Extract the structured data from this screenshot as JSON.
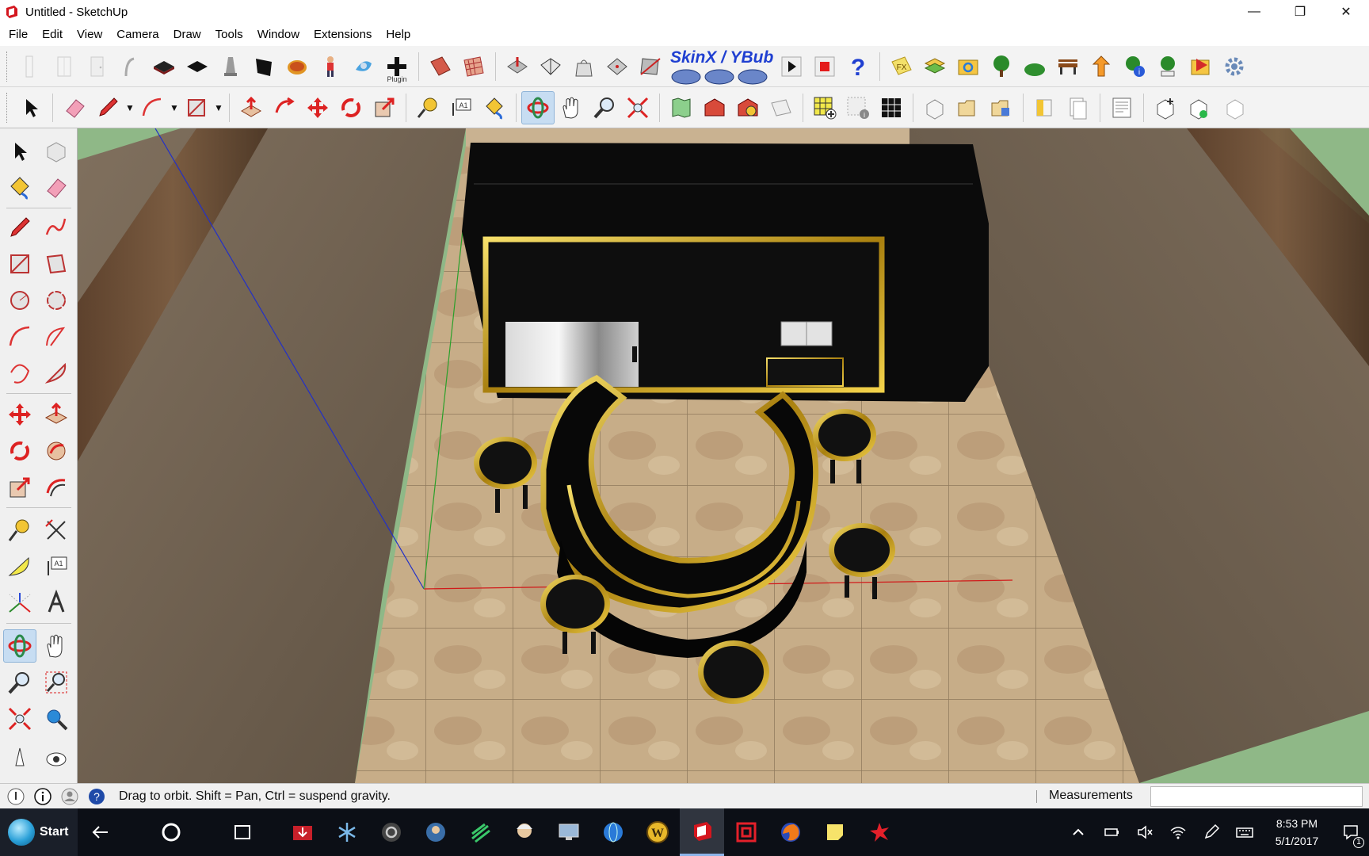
{
  "window": {
    "title": "Untitled - SketchUp",
    "controls": {
      "minimize": "—",
      "maximize": "❐",
      "close": "✕"
    }
  },
  "menu": [
    "File",
    "Edit",
    "View",
    "Camera",
    "Draw",
    "Tools",
    "Window",
    "Extensions",
    "Help"
  ],
  "toolbar1": {
    "plugin_label": "Plugin",
    "skinx_label": "SkinX / YBub"
  },
  "status": {
    "hint": "Drag to orbit. Shift = Pan, Ctrl = suspend gravity.",
    "measurements_label": "Measurements",
    "measurements_value": ""
  },
  "taskbar": {
    "start_label": "Start",
    "time": "8:53 PM",
    "date": "5/1/2017",
    "notification_count": "1"
  },
  "colors": {
    "accent": "#1f3fd1",
    "active_tool_bg": "#c7ddf2",
    "taskbar_bg": "#0c0f16"
  }
}
